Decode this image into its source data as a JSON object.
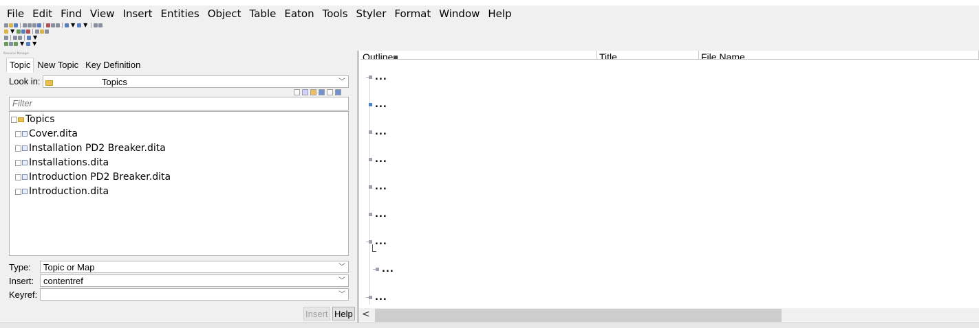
{
  "menubar": {
    "items": [
      "File",
      "Edit",
      "Find",
      "View",
      "Insert",
      "Entities",
      "Object",
      "Table",
      "Eaton",
      "Tools",
      "Styler",
      "Format",
      "Window",
      "Help"
    ]
  },
  "resource_manager": {
    "panel_title": "Resource Manager",
    "tabs": [
      "Topic",
      "New Topic",
      "Key Definition"
    ],
    "active_tab": "Topic",
    "look_in_label": "Look in:",
    "look_in_value": "Topics",
    "filter_placeholder": "Filter",
    "tree": {
      "root": "Topics",
      "children": [
        "Cover.dita",
        "Installation PD2 Breaker.dita",
        "Installations.dita",
        "Introduction PD2 Breaker.dita",
        "Introduction.dita"
      ]
    },
    "type_label": "Type:",
    "type_value": "Topic or Map",
    "insert_label": "Insert:",
    "insert_value": "contentref",
    "keyref_label": "Keyref:",
    "keyref_value": "",
    "insert_button": "Insert",
    "help_button": "Help"
  },
  "map_view": {
    "columns": [
      "Outline",
      "Title",
      "File Name"
    ],
    "rows": [
      "...",
      "...",
      "...",
      "...",
      "...",
      "...",
      "...",
      "...",
      "..."
    ]
  }
}
